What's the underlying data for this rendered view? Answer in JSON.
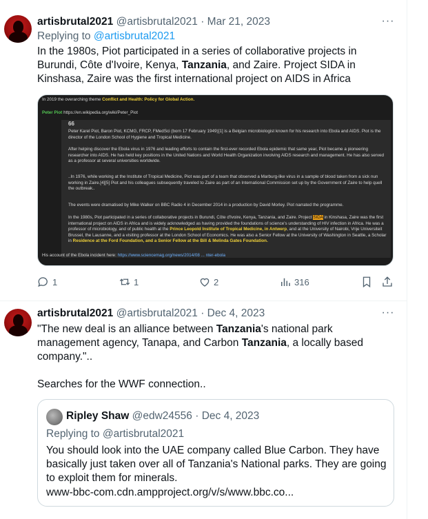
{
  "tweet1": {
    "name": "artisbrutal2021",
    "handle": "@artisbrutal2021",
    "sep": "·",
    "date": "Mar 21, 2023",
    "replying_label": "Replying to",
    "replying_handle": "@artisbrutal2021",
    "text_parts": [
      "In the 1980s, Piot participated in a series of collaborative projects in Burundi, Côte d'Ivoire, Kenya, ",
      "Tanzania",
      ", and Zaire. Project SIDA in Kinshasa, Zaire was the first international project on AIDS in Africa"
    ],
    "media": {
      "line1_prefix": "In 2019 the overarching theme ",
      "line1_theme": "Conflict and Health: Policy for Global Action.",
      "line2_name": "Peter Piot",
      "line2_url": "https://en.wikipedia.org/wiki/Peter_Piot",
      "quote_mark": "66",
      "p1": "Peter Karel Piot, Baron Piot, KCMG, FRCP, FMedSci (born 17 February 1949)[1] is a Belgian microbiologist known for his research into Ebola and AIDS. Piot is the director of the London School of Hygiene and Tropical Medicine.",
      "p2": "After helping discover the Ebola virus in 1976 and leading efforts to contain the first-ever recorded Ebola epidemic that same year, Piot became a pioneering researcher into AIDS. He has held key positions in the United Nations and World Health Organization involving AIDS research and management. He has also served as a professor at several universities worldwide.",
      "p3": "..In 1976, while working at the Institute of Tropical Medicine, Piot was part of a team that observed a Marburg-like virus in a sample of blood taken from a sick nun working in Zaire.[4][5] Piot and his colleagues subsequently traveled to Zaire as part of an International Commission set up by the Government of Zaire to help quell the outbreak..",
      "p4": "The events were dramatised by Mike Walker on BBC Radio 4 in December 2014 in a production by David Morley. Piot narrated the programme.",
      "p5_a": "In the 1980s, Piot participated in a series of collaborative projects in Burundi, Côte d'Ivoire, Kenya, Tanzania, and Zaire. Project ",
      "p5_hl": "SIDA",
      "p5_b": " in Kinshasa, Zaire was the first international project on AIDS in Africa and is widely acknowledged as having provided the foundations of science's understanding of HIV infection in Africa. He was a professor of microbiology, and of public health at the ",
      "p5_y1": "Prince Leopold Institute of Tropical Medicine, in Antwerp",
      "p5_c": ", and at the University of Nairobi, Vrije Universiteit Brussel, the Lausanne, and a visiting professor at the London School of Economics. He was also a Senior Fellow at the University of Washington in Seattle, a Scholar in ",
      "p5_y2": "Residence at the Ford Foundation, and a Senior Fellow at the Bill & Melinda Gates Foundation.",
      "footer_prefix": "His account of the Ebola incident here: ",
      "footer_url": "https://www.sciencemag.org/news/2014/08 ... nter-ebola"
    },
    "actions": {
      "replies": "1",
      "retweets": "1",
      "likes": "2",
      "views": "316"
    }
  },
  "tweet2": {
    "name": "artisbrutal2021",
    "handle": "@artisbrutal2021",
    "sep": "·",
    "date": "Dec 4, 2023",
    "text_line1_parts": [
      "\"The new deal is an alliance between ",
      "Tanzania",
      "'s national park"
    ],
    "text_line2_parts": [
      "management  agency, Tanapa, and Carbon ",
      "Tanzania",
      ", a locally based"
    ],
    "text_line3": "company.\"..",
    "text_line4": "Searches for the WWF connection..",
    "quoted": {
      "name": "Ripley Shaw",
      "handle": "@edw24556",
      "sep": "·",
      "date": "Dec 4, 2023",
      "replying": "Replying to @artisbrutal2021",
      "text": "You should look into the UAE company called Blue Carbon. They have basically just taken over all of Tanzania's National parks. They are going to exploit them for minerals.",
      "link": "www-bbc-com.cdn.ampproject.org/v/s/www.bbc.co..."
    }
  },
  "icons": [
    "more-icon",
    "reply-icon",
    "retweet-icon",
    "like-icon",
    "views-icon",
    "bookmark-icon",
    "share-icon"
  ],
  "colors": {
    "text": "#0f1419",
    "secondary": "#536471",
    "link": "#1d9bf0",
    "border": "#cfd9de"
  }
}
